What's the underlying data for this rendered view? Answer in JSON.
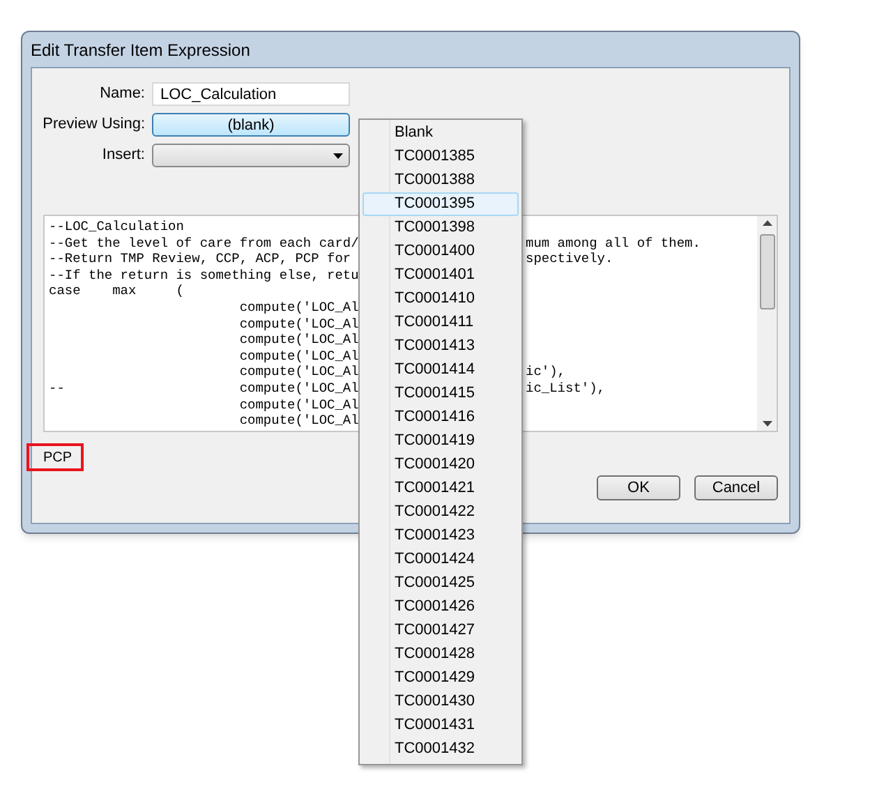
{
  "window": {
    "title": "Edit Transfer Item Expression"
  },
  "name_field": {
    "label": "Name:",
    "value": "LOC_Calculation"
  },
  "preview": {
    "label": "Preview Using:",
    "value": "(blank)"
  },
  "insert": {
    "label": "Insert:"
  },
  "expression": {
    "lines": [
      {
        "left": "--LOC_Calculation"
      },
      {
        "left": "--Get the level of care from each card/",
        "right": "mum among all of them."
      },
      {
        "left": "--Return TMP Review, CCP, ACP, PCP for",
        "right": "spectively."
      },
      {
        "left": "--If the return is something else, retu"
      },
      {
        "left": "case    max     ("
      },
      {
        "left": "                        compute('LOC_Al"
      },
      {
        "left": "                        compute('LOC_Al"
      },
      {
        "left": "                        compute('LOC_Al"
      },
      {
        "left": "                        compute('LOC_Al"
      },
      {
        "left": "                        compute('LOC_Al",
        "right": "ic'),"
      },
      {
        "left": "--                      compute('LOC_Al",
        "right": "ic_List'),"
      },
      {
        "left": "                        compute('LOC_Al"
      },
      {
        "left": "                        compute('LOC_Al"
      }
    ]
  },
  "result": {
    "text": "PCP"
  },
  "buttons": [
    "OK",
    "Cancel"
  ],
  "dropdown": {
    "items": [
      {
        "label": "Blank",
        "selected": false
      },
      {
        "label": "TC0001385",
        "selected": false
      },
      {
        "label": "TC0001388",
        "selected": false
      },
      {
        "label": "TC0001395",
        "selected": true
      },
      {
        "label": "TC0001398",
        "selected": false
      },
      {
        "label": "TC0001400",
        "selected": false
      },
      {
        "label": "TC0001401",
        "selected": false
      },
      {
        "label": "TC0001410",
        "selected": false
      },
      {
        "label": "TC0001411",
        "selected": false
      },
      {
        "label": "TC0001413",
        "selected": false
      },
      {
        "label": "TC0001414",
        "selected": false
      },
      {
        "label": "TC0001415",
        "selected": false
      },
      {
        "label": "TC0001416",
        "selected": false
      },
      {
        "label": "TC0001419",
        "selected": false
      },
      {
        "label": "TC0001420",
        "selected": false
      },
      {
        "label": "TC0001421",
        "selected": false
      },
      {
        "label": "TC0001422",
        "selected": false
      },
      {
        "label": "TC0001423",
        "selected": false
      },
      {
        "label": "TC0001424",
        "selected": false
      },
      {
        "label": "TC0001425",
        "selected": false
      },
      {
        "label": "TC0001426",
        "selected": false
      },
      {
        "label": "TC0001427",
        "selected": false
      },
      {
        "label": "TC0001428",
        "selected": false
      },
      {
        "label": "TC0001429",
        "selected": false
      },
      {
        "label": "TC0001430",
        "selected": false
      },
      {
        "label": "TC0001431",
        "selected": false
      },
      {
        "label": "TC0001432",
        "selected": false
      }
    ]
  }
}
